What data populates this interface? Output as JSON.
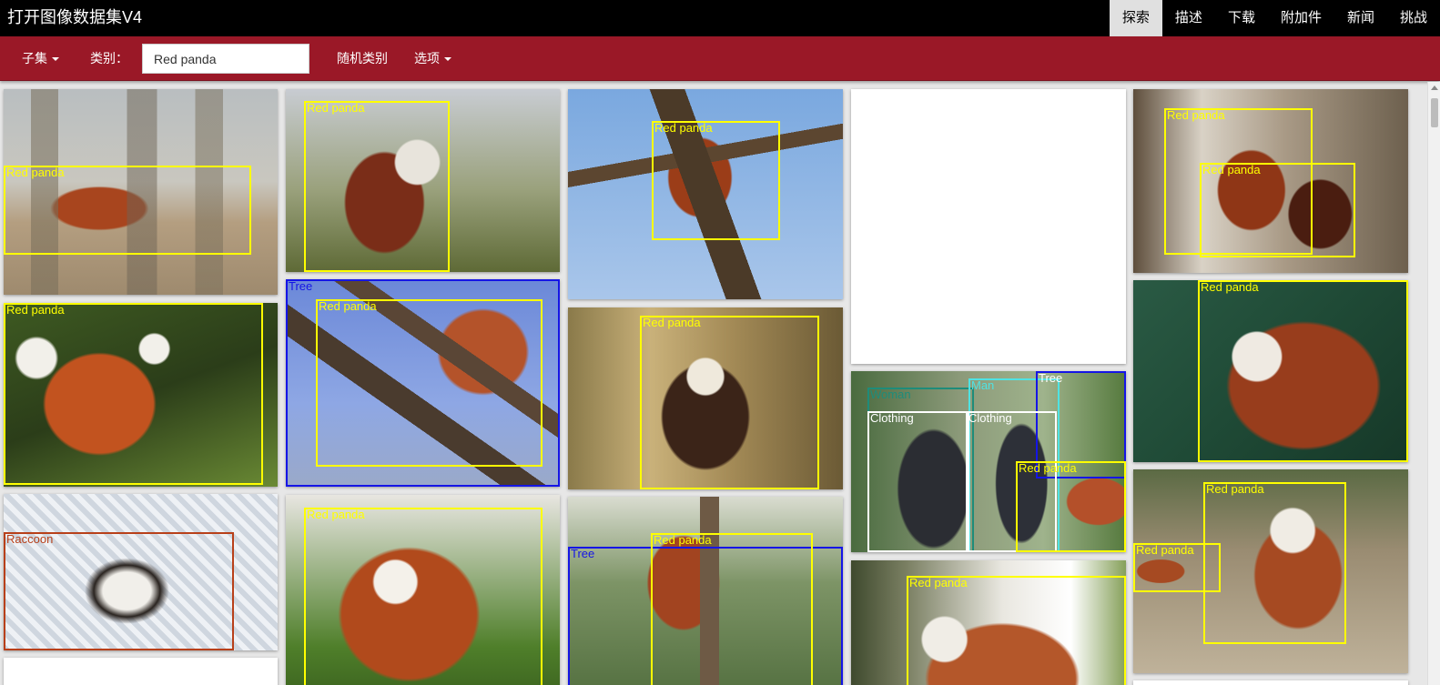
{
  "app": {
    "title": "打开图像数据集V4"
  },
  "nav": [
    {
      "label": "探索",
      "active": true
    },
    {
      "label": "描述",
      "active": false
    },
    {
      "label": "下载",
      "active": false
    },
    {
      "label": "附加件",
      "active": false
    },
    {
      "label": "新闻",
      "active": false
    },
    {
      "label": "挑战",
      "active": false
    }
  ],
  "toolbar": {
    "subset_label": "子集",
    "category_label": "类别：",
    "category_value": "Red panda",
    "random_label": "随机类别",
    "options_label": "选项"
  },
  "colors": {
    "topbar": "#000000",
    "toolbar": "#9a1827",
    "red_panda_box": "#ffff00",
    "tree_box": "#1515e6",
    "raccoon_box": "#b8401a",
    "woman_box": "#1e8c7a",
    "man_box": "#4fe3e3",
    "clothing_box": "#ffffff"
  },
  "label_names": {
    "red_panda": "Red panda",
    "tree": "Tree",
    "raccoon": "Raccoon",
    "woman": "Woman",
    "man": "Man",
    "clothing": "Clothing"
  },
  "gallery": [
    {
      "scene": "panda on log under trees",
      "boxes": [
        "red_panda"
      ]
    },
    {
      "scene": "panda sitting in bamboo",
      "boxes": [
        "red_panda"
      ]
    },
    {
      "scene": "panda on tree against blue sky",
      "boxes": [
        "red_panda"
      ]
    },
    {
      "scene": "blank",
      "boxes": []
    },
    {
      "scene": "two pandas near enclosure",
      "boxes": [
        "red_panda",
        "red_panda"
      ]
    },
    {
      "scene": "panda face in green leaves",
      "boxes": [
        "red_panda"
      ]
    },
    {
      "scene": "panda in branches",
      "boxes": [
        "tree",
        "red_panda"
      ]
    },
    {
      "scene": "panda near bamboo fence",
      "boxes": [
        "red_panda"
      ]
    },
    {
      "scene": "people feeding panda",
      "boxes": [
        "woman",
        "man",
        "tree",
        "clothing",
        "clothing",
        "red_panda"
      ]
    },
    {
      "scene": "panda portrait dark green",
      "boxes": [
        "red_panda"
      ]
    },
    {
      "scene": "panda behind wire fence",
      "boxes": [
        "raccoon"
      ]
    },
    {
      "scene": "panda eating bamboo",
      "boxes": [
        "red_panda"
      ]
    },
    {
      "scene": "panda climbing pine tree",
      "boxes": [
        "tree",
        "red_panda"
      ]
    },
    {
      "scene": "panda with ears near plants",
      "boxes": [
        "red_panda"
      ]
    },
    {
      "scene": "panda on ground with tail",
      "boxes": [
        "red_panda",
        "red_panda"
      ]
    },
    {
      "scene": "blank",
      "boxes": []
    }
  ]
}
